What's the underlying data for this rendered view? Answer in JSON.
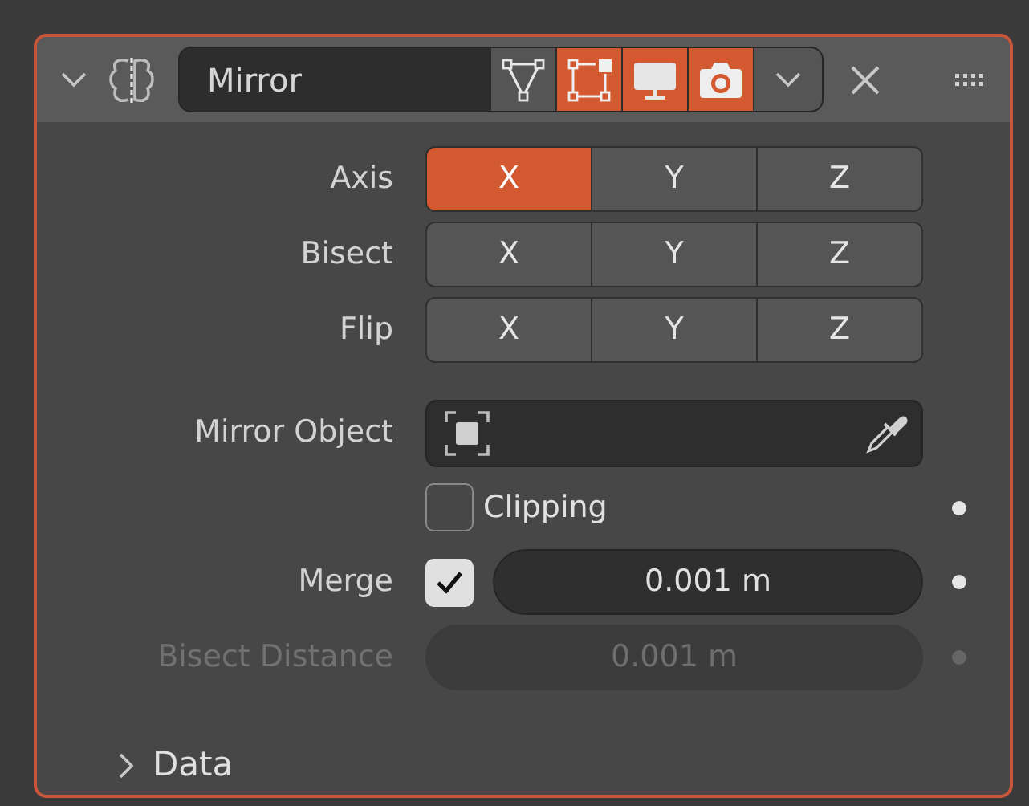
{
  "modifier": {
    "name": "Mirror",
    "expanded": true,
    "toggles": [
      {
        "kind": "edit_mode",
        "on": false
      },
      {
        "kind": "cage",
        "on": true
      },
      {
        "kind": "viewport",
        "on": true
      },
      {
        "kind": "render",
        "on": true
      }
    ]
  },
  "axis_rows": [
    {
      "label": "Axis",
      "options": [
        {
          "text": "X",
          "selected": true
        },
        {
          "text": "Y",
          "selected": false
        },
        {
          "text": "Z",
          "selected": false
        }
      ]
    },
    {
      "label": "Bisect",
      "options": [
        {
          "text": "X",
          "selected": false
        },
        {
          "text": "Y",
          "selected": false
        },
        {
          "text": "Z",
          "selected": false
        }
      ]
    },
    {
      "label": "Flip",
      "options": [
        {
          "text": "X",
          "selected": false
        },
        {
          "text": "Y",
          "selected": false
        },
        {
          "text": "Z",
          "selected": false
        }
      ]
    }
  ],
  "mirror_object": {
    "label": "Mirror Object"
  },
  "clipping": {
    "label": "Clipping",
    "checked": false
  },
  "merge": {
    "label": "Merge",
    "checked": true,
    "value": "0.001 m"
  },
  "bisect_distance": {
    "label": "Bisect Distance",
    "value": "0.001 m",
    "disabled": true
  },
  "subpanels": [
    {
      "label": "Data",
      "expanded": false
    }
  ]
}
